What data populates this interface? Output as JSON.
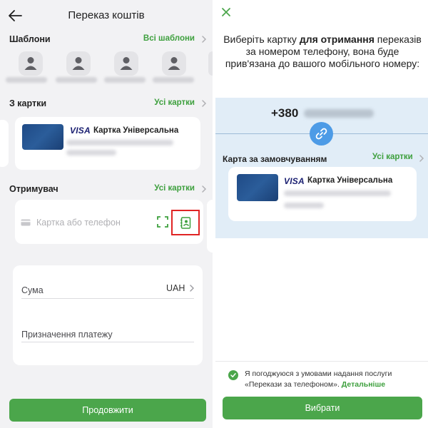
{
  "left": {
    "header": {
      "title": "Переказ коштів"
    },
    "templates": {
      "label": "Шаблони",
      "all_link": "Всі шаблони"
    },
    "from_cards": {
      "label": "З картки",
      "all_link": "Усі картки",
      "card": {
        "brand": "VISA",
        "name": "Картка Універсальна"
      }
    },
    "recipient": {
      "label": "Отримувач",
      "all_link": "Усі картки",
      "input_placeholder": "Картка або телефон",
      "input_value": ""
    },
    "amount": {
      "sum_label": "Сума",
      "currency": "UAH",
      "purpose_label": "Призначення платежу"
    },
    "continue_button": "Продовжити"
  },
  "right": {
    "instruction": {
      "part1": "Виберіть картку ",
      "bold": "для отримання",
      "part2": " переказів за номером телефону, вона буде прив'язана до вашого мобільного номеру:"
    },
    "phone_prefix": "+380",
    "default_card": {
      "label": "Карта за замовчуванням",
      "all_link": "Усі картки",
      "card": {
        "brand": "VISA",
        "name": "Картка Універсальна"
      }
    },
    "agreement": {
      "text": "Я погоджуюся з умовами надання послуги «Перекази за телефоном».",
      "link": "Детальніше",
      "checked": true
    },
    "choose_button": "Вибрати"
  },
  "colors": {
    "accent_green": "#4ba64b",
    "link_green": "#3ea03e",
    "highlight_red": "#e02424",
    "panel_blue": "#e1edf7",
    "link_blue": "#4d9be6"
  },
  "icons": [
    "arrow-left-icon",
    "person-icon",
    "chevron-right-icon",
    "card-icon",
    "scan-icon",
    "contacts-book-icon",
    "close-x-icon",
    "link-chain-icon",
    "check-icon"
  ]
}
